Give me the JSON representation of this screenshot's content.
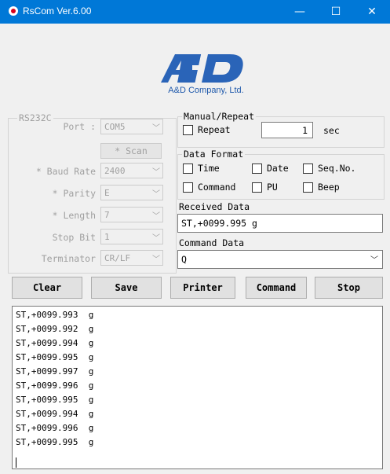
{
  "window": {
    "title": "RsCom Ver.6.00",
    "controls": {
      "minimize": "—",
      "maximize": "☐",
      "close": "✕"
    }
  },
  "logo": {
    "company": "A&D Company, Ltd.",
    "brand_color": "#1f59ab",
    "mark_color": "#2a64b8"
  },
  "rs232c": {
    "legend": "RS232C",
    "port_label": "Port :",
    "port_value": "COM5",
    "scan_label": "* Scan",
    "baud_label": "* Baud Rate",
    "baud_value": "2400",
    "parity_label": "* Parity",
    "parity_value": "E",
    "length_label": "* Length",
    "length_value": "7",
    "stopbit_label": "Stop Bit",
    "stopbit_value": "1",
    "terminator_label": "Terminator",
    "terminator_value": "CR/LF"
  },
  "manual_repeat": {
    "legend": "Manual/Repeat",
    "repeat_label": "Repeat",
    "repeat_checked": false,
    "interval_value": "1",
    "unit": "sec"
  },
  "data_format": {
    "legend": "Data Format",
    "options": [
      {
        "label": "Time",
        "checked": false
      },
      {
        "label": "Date",
        "checked": false
      },
      {
        "label": "Seq.No.",
        "checked": false
      },
      {
        "label": "Command",
        "checked": false
      },
      {
        "label": "PU",
        "checked": false
      },
      {
        "label": "Beep",
        "checked": false
      }
    ]
  },
  "received": {
    "label": "Received Data",
    "value": "ST,+0099.995  g"
  },
  "command": {
    "label": "Command Data",
    "value": "Q"
  },
  "buttons": {
    "clear": "Clear",
    "save": "Save",
    "printer": "Printer",
    "command": "Command",
    "stop": "Stop"
  },
  "log": {
    "lines": [
      "ST,+0099.993  g",
      "ST,+0099.992  g",
      "ST,+0099.994  g",
      "ST,+0099.995  g",
      "ST,+0099.997  g",
      "ST,+0099.996  g",
      "ST,+0099.995  g",
      "ST,+0099.994  g",
      "ST,+0099.996  g",
      "ST,+0099.995  g"
    ]
  }
}
